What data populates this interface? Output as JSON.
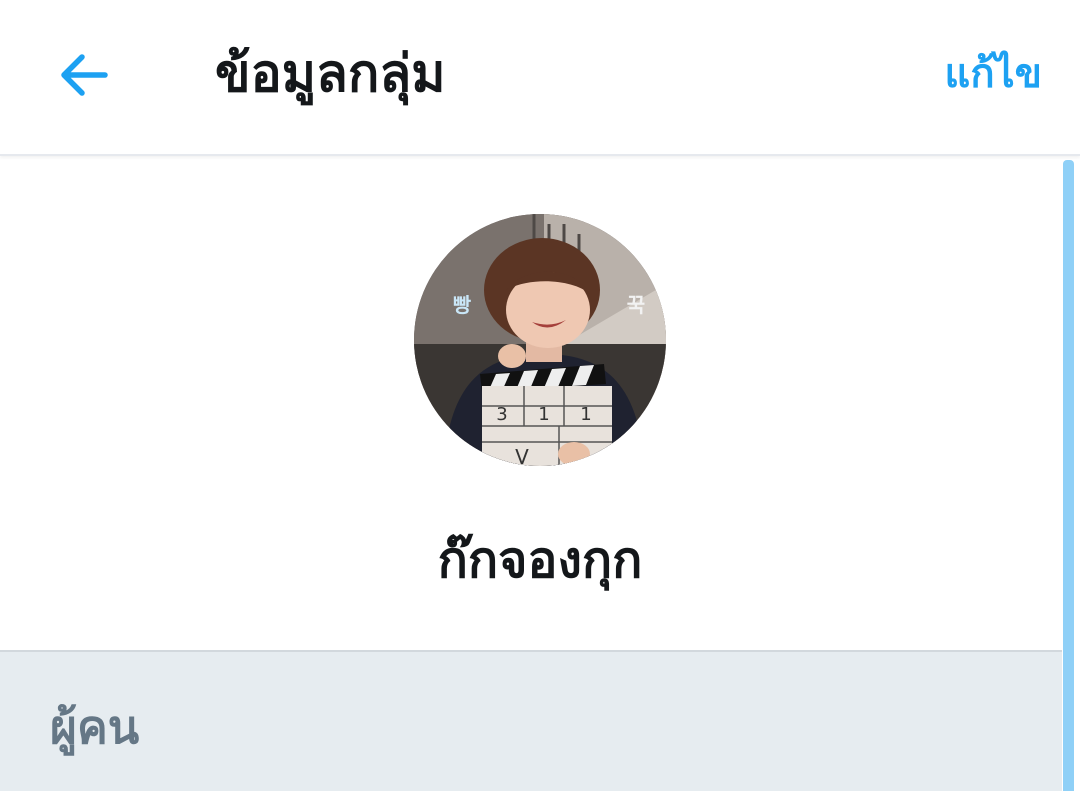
{
  "header": {
    "title": "ข้อมูลกลุ่ม",
    "edit_label": "แก้ไข",
    "back_icon": "arrow-left-icon"
  },
  "group": {
    "name": "ก๊กจองกุก",
    "avatar": {
      "left_caption": "빵",
      "right_caption": "꾹",
      "slate_scene": "3",
      "slate_cut": "1",
      "slate_take": "1",
      "slate_mark": "V"
    }
  },
  "people_section": {
    "label": "ผู้คน"
  },
  "colors": {
    "accent": "#1da1f2",
    "title_text": "#14171a",
    "section_bg": "#e6ecf0",
    "section_text": "#657786",
    "scrollbar": "#8fd0f7"
  }
}
